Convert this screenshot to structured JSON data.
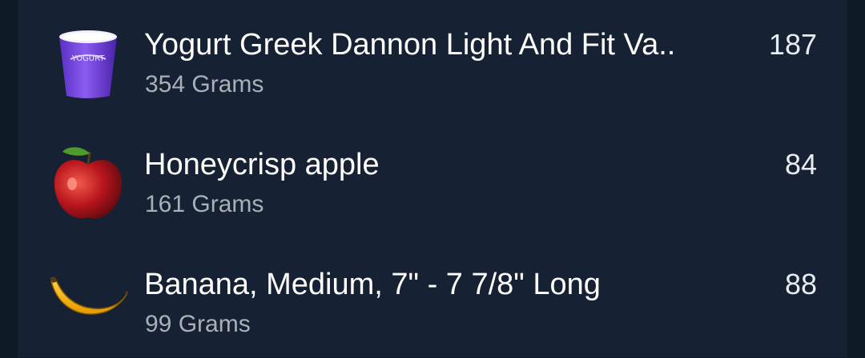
{
  "food_list": {
    "items": [
      {
        "name": "Yogurt Greek Dannon Light And Fit Va..",
        "amount": "354 Grams",
        "calories": "187",
        "icon": "yogurt-cup-icon",
        "icon_label": "YOGURT"
      },
      {
        "name": "Honeycrisp apple",
        "amount": "161 Grams",
        "calories": "84",
        "icon": "apple-icon"
      },
      {
        "name": "Banana, Medium, 7\" - 7 7/8\" Long",
        "amount": "99 Grams",
        "calories": "88",
        "icon": "banana-icon"
      }
    ]
  },
  "colors": {
    "background": "#0f1a27",
    "panel": "#162233",
    "primary_text": "#ffffff",
    "secondary_text": "#a9b0b8"
  }
}
